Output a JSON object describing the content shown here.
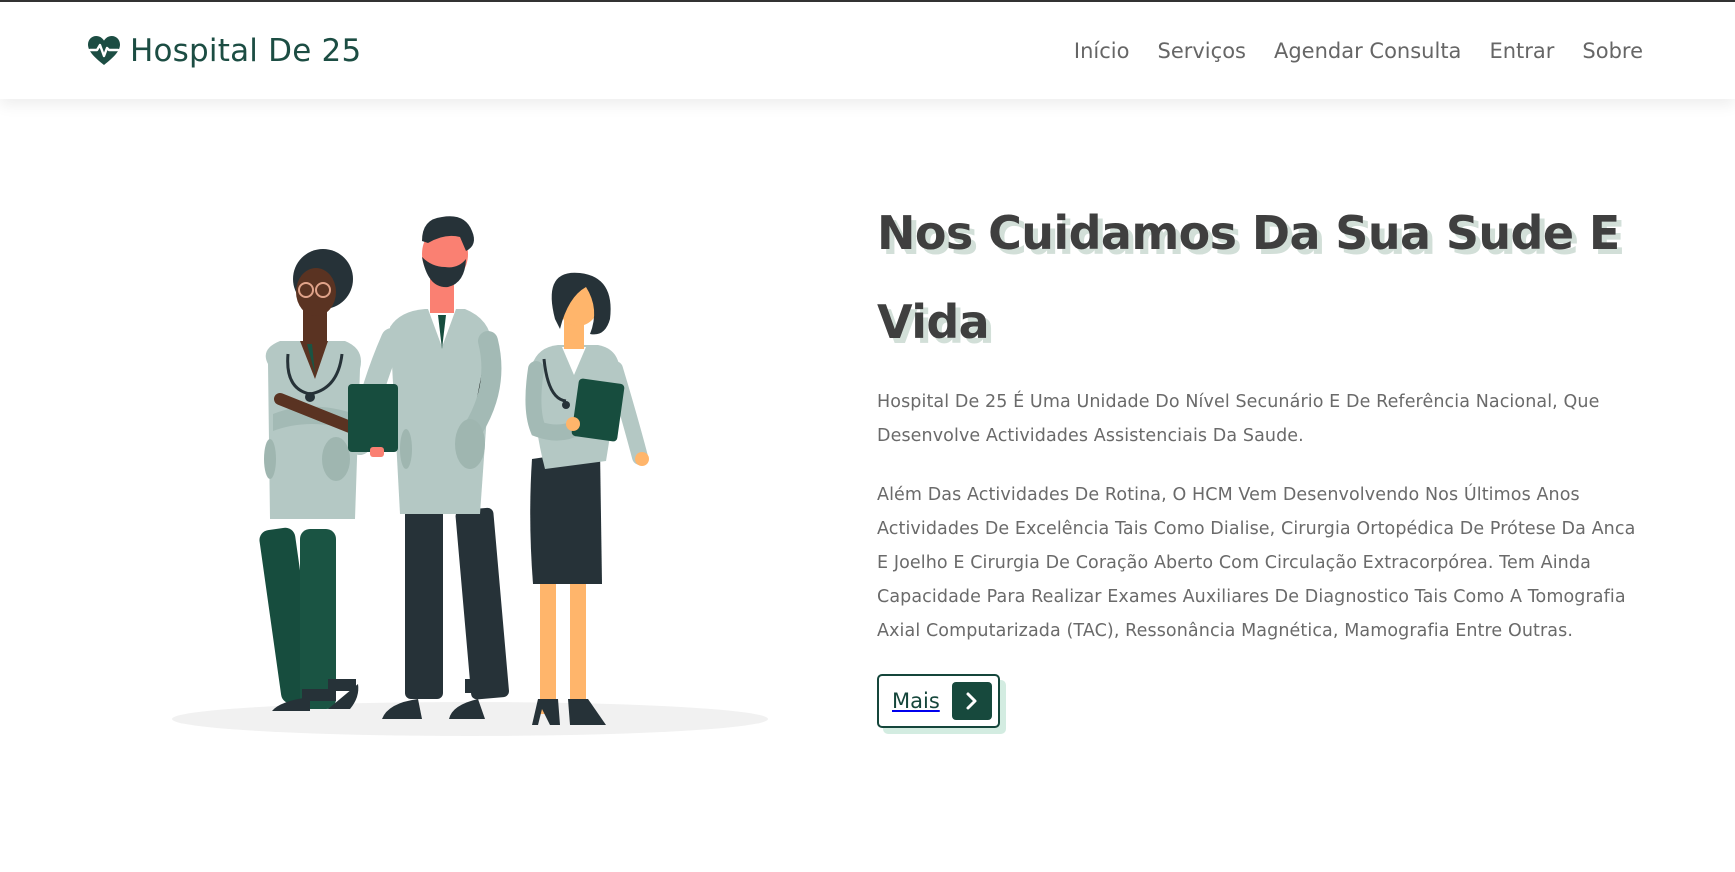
{
  "header": {
    "brand": "Hospital De 25",
    "nav": [
      {
        "label": "Início"
      },
      {
        "label": "Serviços"
      },
      {
        "label": "Agendar Consulta"
      },
      {
        "label": "Entrar"
      },
      {
        "label": "Sobre"
      }
    ]
  },
  "hero": {
    "title": "Nos Cuidamos Da Sua Sude E Vida",
    "paragraph1": "Hospital De 25 É Uma Unidade Do Nível Secunário E De Referência Nacional, Que Desenvolve Actividades Assistenciais Da Saude.",
    "paragraph2": "Além Das Actividades De Rotina, O HCM Vem Desenvolvendo Nos Últimos Anos Actividades De Excelência Tais Como Dialise, Cirurgia Ortopédica De Prótese Da Anca E Joelho E Cirurgia De Coração Aberto Com Circulação Extracorpórea. Tem Ainda Capacidade Para Realizar Exames Auxiliares De Diagnostico Tais Como A Tomografia Axial Computarizada (TAC), Ressonância Magnética, Mamografia Entre Outras.",
    "button_label": "Mais"
  },
  "icons": {
    "logo": "heartbeat-icon",
    "button": "chevron-right-icon"
  },
  "colors": {
    "brand": "#1c4d43",
    "button_bg": "#17493d",
    "title_shadow": "#d2dfd8",
    "button_shadow": "#d3ece1"
  }
}
